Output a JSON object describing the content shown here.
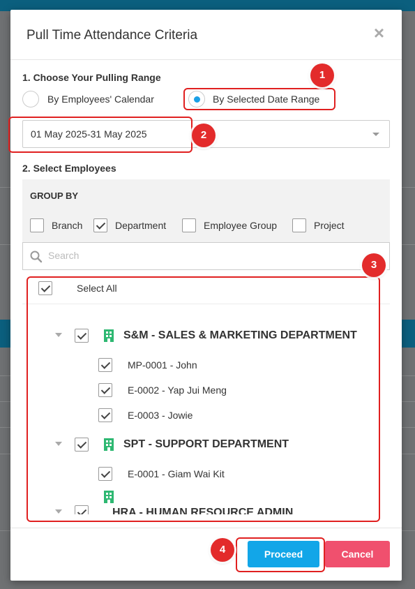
{
  "modal": {
    "title": "Pull Time Attendance Criteria",
    "close_icon": "close-icon"
  },
  "pulling_range": {
    "label": "1. Choose Your Pulling Range",
    "options": [
      {
        "label": "By Employees' Calendar",
        "selected": false
      },
      {
        "label": "By Selected Date Range",
        "selected": true
      }
    ],
    "date_range_value": "01 May 2025-31 May 2025"
  },
  "employees": {
    "label": "2. Select Employees",
    "group_by": {
      "title": "GROUP BY",
      "options": [
        {
          "label": "Branch",
          "checked": false
        },
        {
          "label": "Department",
          "checked": true
        },
        {
          "label": "Employee Group",
          "checked": false
        },
        {
          "label": "Project",
          "checked": false
        }
      ]
    },
    "search_placeholder": "Search",
    "select_all_label": "Select All",
    "departments": [
      {
        "name": "S&M - SALES & MARKETING DEPARTMENT",
        "checked": true,
        "employees": [
          "MP-0001 - John",
          "E-0002 - Yap Jui Meng",
          "E-0003 - Jowie"
        ]
      },
      {
        "name": "SPT - SUPPORT DEPARTMENT",
        "checked": true,
        "employees": [
          "E-0001 - Giam Wai Kit"
        ]
      },
      {
        "name": "HRA - HUMAN RESOURCE ADMIN DEPARTMENT",
        "checked": true,
        "employees": []
      }
    ]
  },
  "footer": {
    "proceed_label": "Proceed",
    "cancel_label": "Cancel"
  },
  "annotations": [
    "1",
    "2",
    "3",
    "4"
  ],
  "colors": {
    "accent": "#12a6e8",
    "cancel": "#f0506e",
    "annotation": "#e32b2b",
    "building_icon": "#2eb872"
  }
}
